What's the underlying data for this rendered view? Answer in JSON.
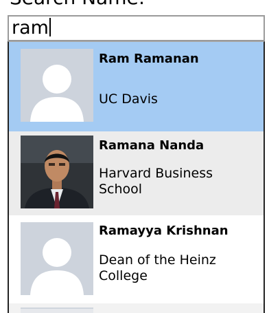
{
  "search": {
    "label": "Search Name:",
    "query": "ram"
  },
  "results": [
    {
      "name": "Ram Ramanan",
      "affiliation": "UC Davis",
      "photo": "default-avatar-icon",
      "selected": true
    },
    {
      "name": "Ramana Nanda",
      "affiliation": "Harvard Business School",
      "photo": "profile-photo"
    },
    {
      "name": "Ramayya Krishnan",
      "affiliation": "Dean of the Heinz College",
      "photo": "default-avatar-icon"
    }
  ],
  "colors": {
    "selected_bg": "#a4cbf3",
    "alt_row_bg": "#ececec",
    "placeholder_avatar": "#cdd3dc"
  }
}
